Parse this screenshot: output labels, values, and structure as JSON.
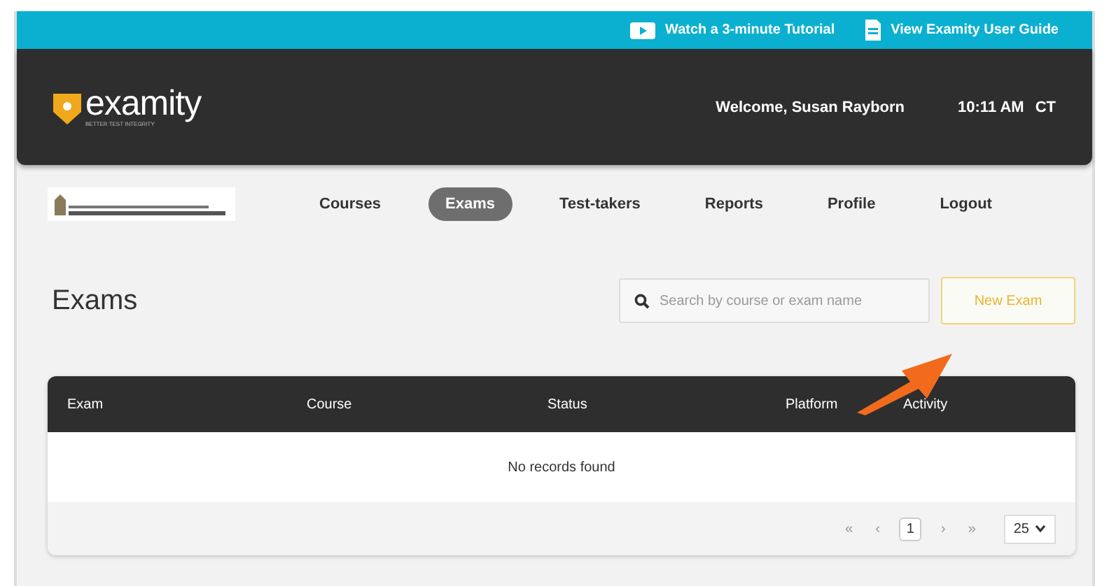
{
  "top_bar": {
    "tutorial_link": "Watch a 3-minute Tutorial",
    "guide_link": "View Examity User Guide"
  },
  "header": {
    "logo_text": "examity",
    "logo_tagline": "BETTER TEST INTEGRITY",
    "welcome": "Welcome, Susan Rayborn",
    "time": "10:11 AM",
    "timezone": "CT"
  },
  "nav": [
    {
      "label": "Courses",
      "selected": false
    },
    {
      "label": "Exams",
      "selected": true
    },
    {
      "label": "Test-takers",
      "selected": false
    },
    {
      "label": "Reports",
      "selected": false
    },
    {
      "label": "Profile",
      "selected": false
    },
    {
      "label": "Logout",
      "selected": false
    }
  ],
  "page_title": "Exams",
  "search": {
    "placeholder": "Search by course or exam name"
  },
  "new_button": "New Exam",
  "table": {
    "columns": [
      "Exam",
      "Course",
      "Status",
      "Platform",
      "Activity"
    ],
    "empty_message": "No records found"
  },
  "pagination": {
    "first": "«",
    "prev": "‹",
    "page": "1",
    "next": "›",
    "last": "»",
    "page_size": "25"
  }
}
